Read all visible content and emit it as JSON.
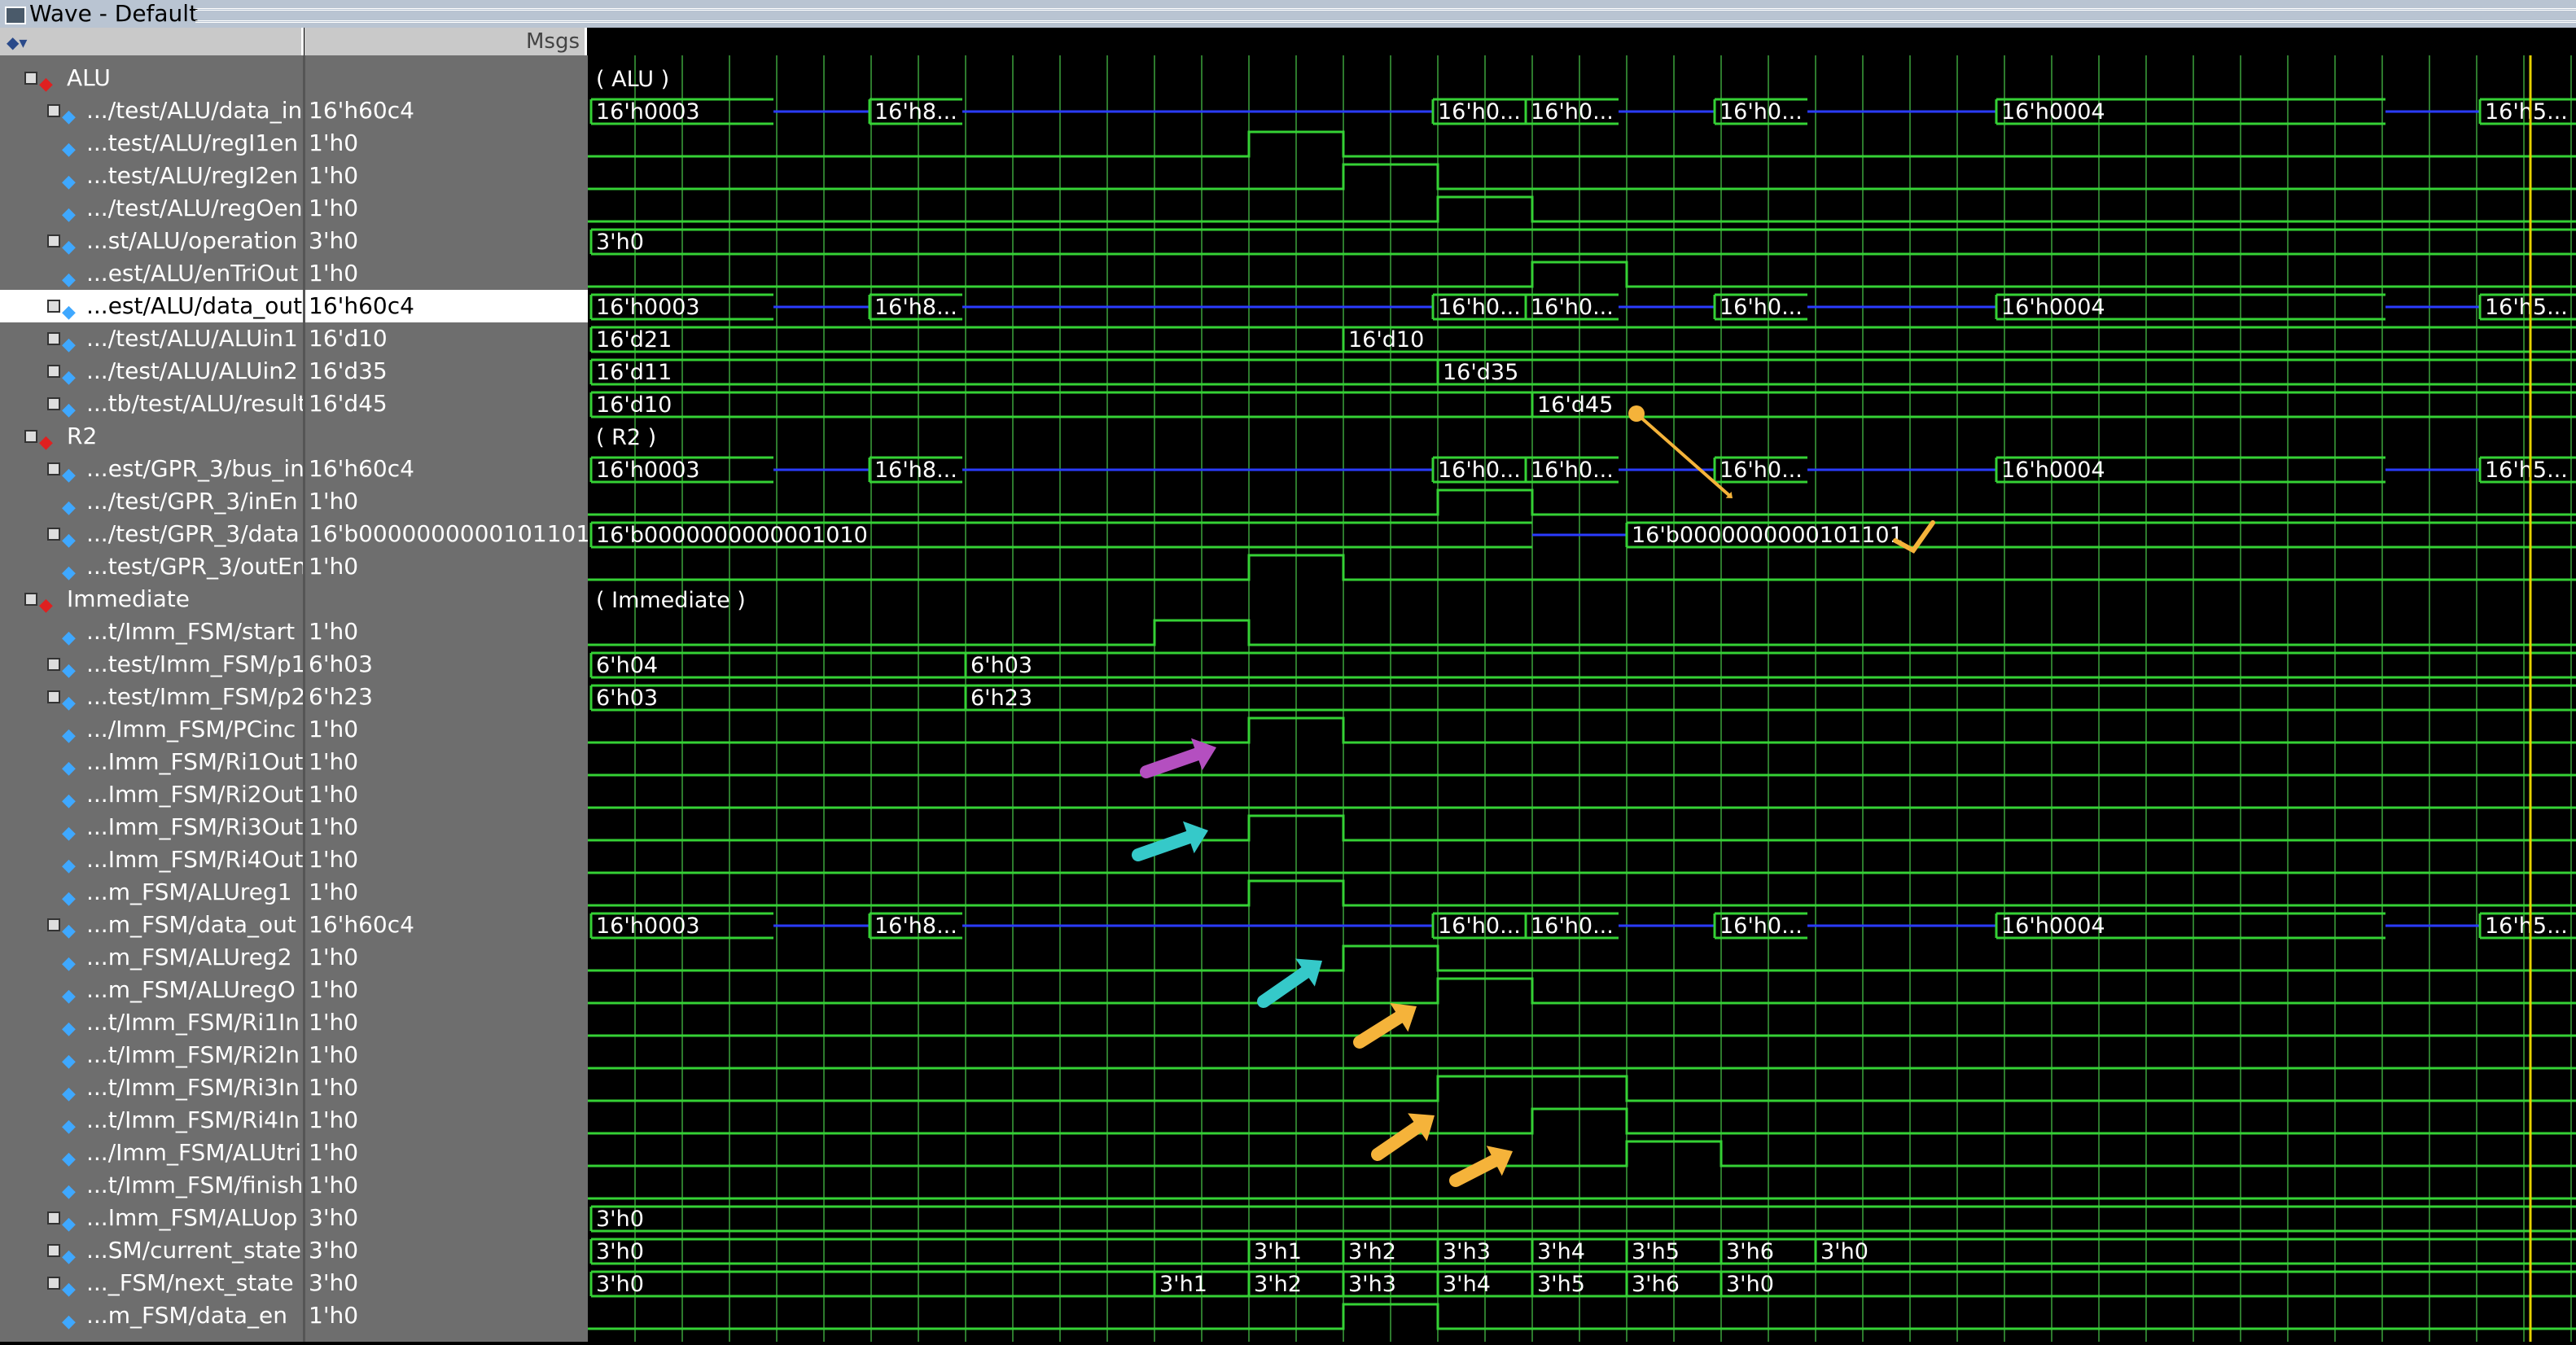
{
  "window": {
    "title": "Wave - Default"
  },
  "header": {
    "msgs_label": "Msgs"
  },
  "rows": [
    {
      "name": "ALU",
      "value": "",
      "group": true
    },
    {
      "name": ".../test/ALU/data_in",
      "value": "16'h60c4",
      "bus": true
    },
    {
      "name": "...test/ALU/regI1en",
      "value": "1'h0"
    },
    {
      "name": "...test/ALU/regI2en",
      "value": "1'h0"
    },
    {
      "name": ".../test/ALU/regOen",
      "value": "1'h0"
    },
    {
      "name": "...st/ALU/operation",
      "value": "3'h0",
      "bus": true
    },
    {
      "name": "...est/ALU/enTriOut",
      "value": "1'h0"
    },
    {
      "name": "...est/ALU/data_out",
      "value": "16'h60c4",
      "bus": true,
      "selected": true
    },
    {
      "name": ".../test/ALU/ALUin1",
      "value": "16'd10",
      "bus": true
    },
    {
      "name": ".../test/ALU/ALUin2",
      "value": "16'd35",
      "bus": true
    },
    {
      "name": "...tb/test/ALU/result",
      "value": "16'd45",
      "bus": true
    },
    {
      "name": "R2",
      "value": "",
      "group": true
    },
    {
      "name": "...est/GPR_3/bus_in",
      "value": "16'h60c4",
      "bus": true
    },
    {
      "name": ".../test/GPR_3/inEn",
      "value": "1'h0"
    },
    {
      "name": ".../test/GPR_3/data",
      "value": "16'b0000000000101101",
      "bus": true
    },
    {
      "name": "...test/GPR_3/outEn",
      "value": "1'h0"
    },
    {
      "name": "Immediate",
      "value": "",
      "group": true
    },
    {
      "name": "...t/Imm_FSM/start",
      "value": "1'h0"
    },
    {
      "name": "...test/Imm_FSM/p1",
      "value": "6'h03",
      "bus": true
    },
    {
      "name": "...test/Imm_FSM/p2",
      "value": "6'h23",
      "bus": true
    },
    {
      "name": ".../Imm_FSM/PCinc",
      "value": "1'h0"
    },
    {
      "name": "...Imm_FSM/Ri1Out",
      "value": "1'h0"
    },
    {
      "name": "...Imm_FSM/Ri2Out",
      "value": "1'h0"
    },
    {
      "name": "...Imm_FSM/Ri3Out",
      "value": "1'h0"
    },
    {
      "name": "...Imm_FSM/Ri4Out",
      "value": "1'h0"
    },
    {
      "name": "...m_FSM/ALUreg1",
      "value": "1'h0"
    },
    {
      "name": "...m_FSM/data_out",
      "value": "16'h60c4",
      "bus": true
    },
    {
      "name": "...m_FSM/ALUreg2",
      "value": "1'h0"
    },
    {
      "name": "...m_FSM/ALUregO",
      "value": "1'h0"
    },
    {
      "name": "...t/Imm_FSM/Ri1In",
      "value": "1'h0"
    },
    {
      "name": "...t/Imm_FSM/Ri2In",
      "value": "1'h0"
    },
    {
      "name": "...t/Imm_FSM/Ri3In",
      "value": "1'h0"
    },
    {
      "name": "...t/Imm_FSM/Ri4In",
      "value": "1'h0"
    },
    {
      "name": ".../Imm_FSM/ALUtri",
      "value": "1'h0"
    },
    {
      "name": "...t/Imm_FSM/finish",
      "value": "1'h0"
    },
    {
      "name": "...Imm_FSM/ALUop",
      "value": "3'h0",
      "bus": true
    },
    {
      "name": "...SM/current_state",
      "value": "3'h0",
      "bus": true
    },
    {
      "name": "..._FSM/next_state",
      "value": "3'h0",
      "bus": true
    },
    {
      "name": "...m_FSM/data_en",
      "value": "1'h0"
    }
  ],
  "waves": {
    "group_labels": [
      "( ALU )",
      "( R2 )",
      "( Immediate )"
    ],
    "bus_labels": {
      "data16": [
        "16'h0003",
        "16'h8...",
        "16'h0...",
        "16'h0...",
        "16'h0...",
        "16'h0004",
        "16'h5..."
      ],
      "operation": "3'h0",
      "ALUin1": [
        "16'd21",
        "16'd10"
      ],
      "ALUin2": [
        "16'd11",
        "16'd35"
      ],
      "result": [
        "16'd10",
        "16'd45"
      ],
      "gpr_data": [
        "16'b0000000000001010",
        "16'b0000000000101101"
      ],
      "p1": [
        "6'h04",
        "6'h03"
      ],
      "p2": [
        "6'h03",
        "6'h23"
      ],
      "ALUop": "3'h0",
      "current_state": [
        "3'h0",
        "3'h1",
        "3'h2",
        "3'h3",
        "3'h4",
        "3'h5",
        "3'h6",
        "3'h0"
      ],
      "next_state": [
        "3'h0",
        "3'h1",
        "3'h2",
        "3'h3",
        "3'h4",
        "3'h5",
        "3'h6",
        "3'h0"
      ]
    },
    "colors": {
      "wave": "#35d135",
      "grid": "#2d7a2d",
      "hiz": "#2a3cff",
      "cursor": "#e6d000",
      "annot_orange": "#f5b33a",
      "annot_purple": "#b44fc0",
      "annot_cyan": "#35c9c9"
    },
    "annotations": [
      "check-mark",
      "arrow-result-to-data",
      "arrow-purple",
      "arrow-cyan-1",
      "arrow-cyan-2",
      "arrow-orange-1",
      "arrow-orange-2",
      "arrow-orange-3"
    ]
  }
}
